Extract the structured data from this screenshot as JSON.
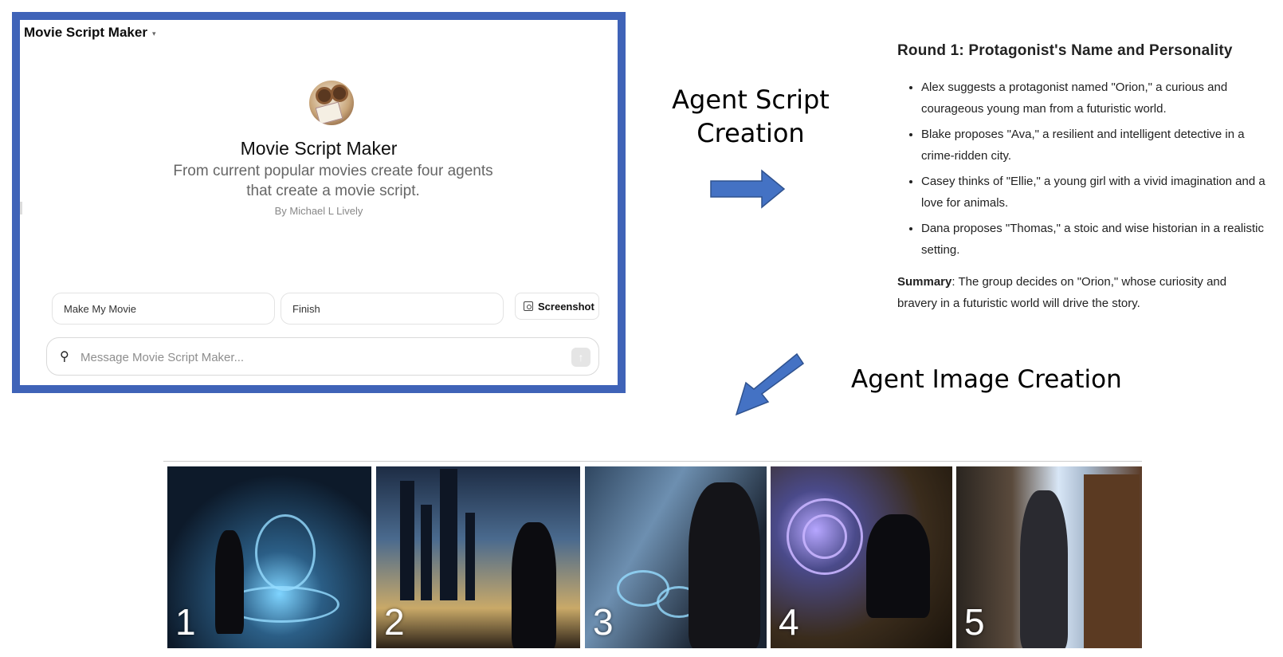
{
  "gpt_window": {
    "title": "Movie Script Maker",
    "name": "Movie Script Maker",
    "description": "From current popular movies create four agents that create a movie script.",
    "author": "By Michael L Lively",
    "starters": [
      "Make My Movie",
      "Finish"
    ],
    "screenshot_label": "Screenshot",
    "composer_placeholder": "Message Movie Script Maker...",
    "frame_color": "#3f63b8"
  },
  "labels": {
    "script_line1": "Agent Script",
    "script_line2": "Creation",
    "image": "Agent Image Creation"
  },
  "round": {
    "title": "Round 1: Protagonist's Name and Personality",
    "items": [
      "Alex suggests a protagonist named \"Orion,\" a curious and courageous young man from a futuristic world.",
      "Blake proposes \"Ava,\" a resilient and intelligent detective in a crime-ridden city.",
      "Casey thinks of \"Ellie,\" a young girl with a vivid imagination and a love for animals.",
      "Dana proposes \"Thomas,\" a stoic and wise historian in a realistic setting."
    ],
    "summary_label": "Summary",
    "summary_text": ": The group decides on \"Orion,\" whose curiosity and bravery in a futuristic world will drive the story."
  },
  "images": [
    {
      "number": "1"
    },
    {
      "number": "2"
    },
    {
      "number": "3"
    },
    {
      "number": "4"
    },
    {
      "number": "5"
    }
  ],
  "icons": {
    "chevron": "chevron-down-icon",
    "attach": "paperclip-icon",
    "send": "arrow-up-icon",
    "screenshot": "screenshot-icon"
  },
  "arrow_color": "#4472c4"
}
